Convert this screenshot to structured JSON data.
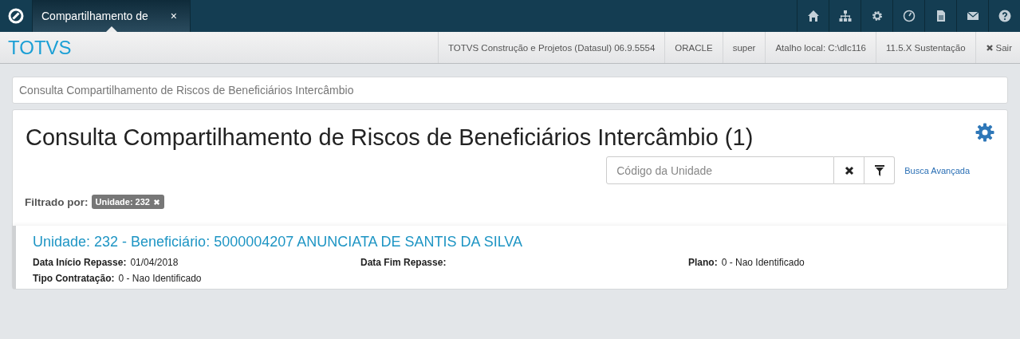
{
  "tabs": [
    {
      "label": "Compartilhamento de",
      "selected": true,
      "close": "×"
    }
  ],
  "brand": "TOTVS",
  "status_items": [
    "TOTVS Construção e Projetos (Datasul) 06.9.5554",
    "ORACLE",
    "super",
    "Atalho local: C:\\dlc116",
    "11.5.X Sustentação"
  ],
  "logout": "Sair",
  "breadcrumb": "Consulta Compartilhamento de Riscos de Beneficiários Intercâmbio",
  "page_title": "Consulta Compartilhamento de Riscos de Beneficiários Intercâmbio (1)",
  "search": {
    "placeholder": "Código da Unidade"
  },
  "advanced_link": "Busca Avançada",
  "filter": {
    "label": "Filtrado por:",
    "tags": [
      "Unidade: 232"
    ]
  },
  "results": [
    {
      "title": "Unidade: 232 - Beneficiário: 5000004207 ANUNCIATA DE SANTIS DA SILVA",
      "fields": [
        {
          "label": "Data Início Repasse:",
          "value": "01/04/2018"
        },
        {
          "label": "Data Fim Repasse:"
        },
        {
          "label": "Plano:",
          "value": "0 - Nao Identificado"
        },
        {
          "label": "Tipo Contratação:",
          "value": "0 - Nao Identificado"
        }
      ]
    }
  ]
}
